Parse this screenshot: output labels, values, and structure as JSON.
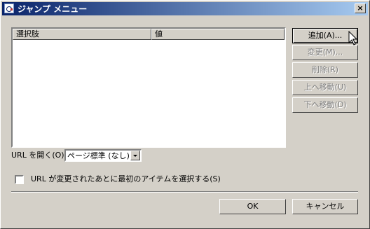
{
  "window": {
    "title": "ジャンプ メニュー",
    "close_label": "×"
  },
  "list": {
    "columns": [
      "選択肢",
      "値"
    ],
    "rows": []
  },
  "buttons": {
    "add": "追加(A)...",
    "edit": "変更(M)...",
    "delete": "削除(R)",
    "move_up": "上へ移動(U)",
    "move_down": "下へ移動(D)",
    "ok": "OK",
    "cancel": "キャンセル"
  },
  "open_url": {
    "label": "URL を開く(O):",
    "selected": "ページ標準 (なし)"
  },
  "select_first": {
    "label": "URL が変更されたあとに最初のアイテムを選択する(S)",
    "checked": false
  }
}
